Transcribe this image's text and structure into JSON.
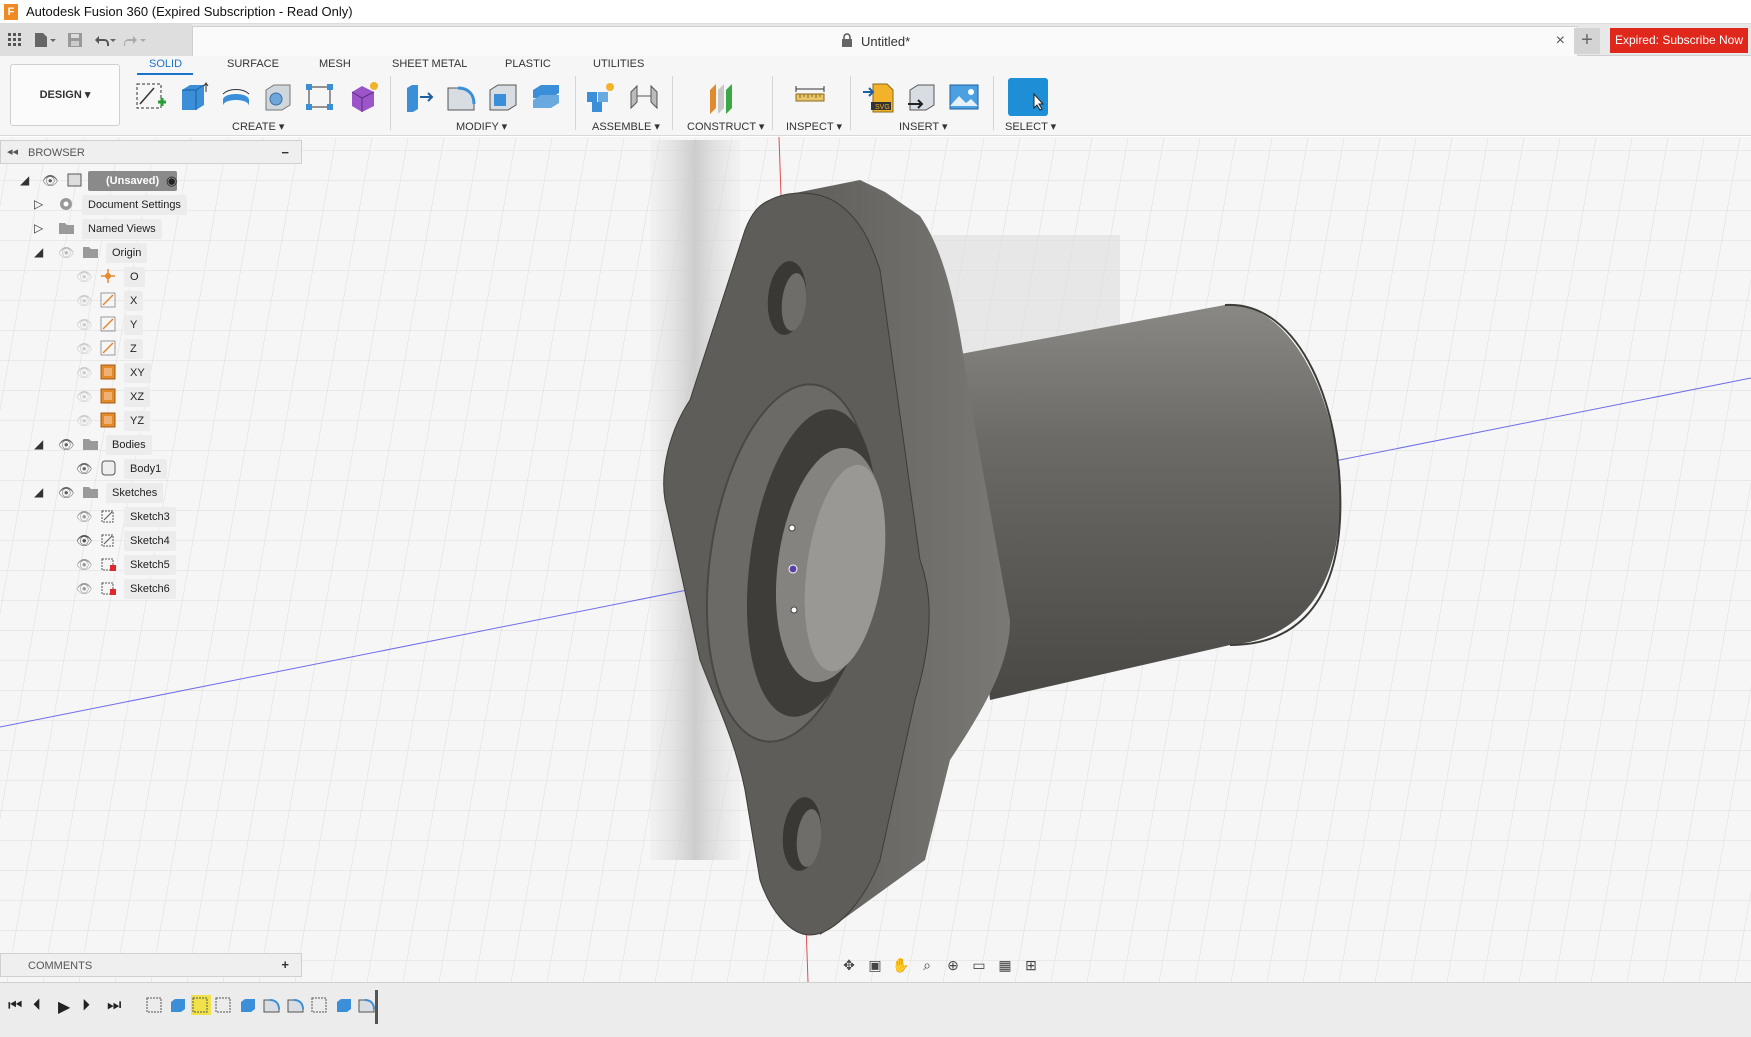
{
  "window": {
    "title": "Autodesk Fusion 360 (Expired Subscription - Read Only)",
    "logo_letter": "F"
  },
  "document_tab": {
    "name": "Untitled*",
    "close_glyph": "×",
    "new_tab_glyph": "+"
  },
  "subscribe_button": "Expired: Subscribe Now",
  "workspace_button": "DESIGN ▾",
  "ribbon_tabs": [
    "SOLID",
    "SURFACE",
    "MESH",
    "SHEET METAL",
    "PLASTIC",
    "UTILITIES"
  ],
  "ribbon_groups": {
    "create": "CREATE ▾",
    "modify": "MODIFY ▾",
    "assemble": "ASSEMBLE ▾",
    "construct": "CONSTRUCT ▾",
    "inspect": "INSPECT ▾",
    "insert": "INSERT ▾",
    "select": "SELECT ▾"
  },
  "browser": {
    "title": "BROWSER",
    "collapse_glyph": "◂◂",
    "minimize_glyph": "−",
    "root_label": "(Unsaved)",
    "items": {
      "document_settings": "Document Settings",
      "named_views": "Named Views",
      "origin": "Origin",
      "origin_o": "O",
      "origin_x": "X",
      "origin_y": "Y",
      "origin_z": "Z",
      "origin_xy": "XY",
      "origin_xz": "XZ",
      "origin_yz": "YZ",
      "bodies": "Bodies",
      "body1": "Body1",
      "sketches": "Sketches",
      "sketch3": "Sketch3",
      "sketch4": "Sketch4",
      "sketch5": "Sketch5",
      "sketch6": "Sketch6"
    }
  },
  "comments": {
    "title": "COMMENTS",
    "add_glyph": "+"
  },
  "colors": {
    "accent_blue": "#1a73c8",
    "expired_red": "#e0271c",
    "part_gray": "#5c5a56",
    "select_blue": "#1e8fd6"
  }
}
